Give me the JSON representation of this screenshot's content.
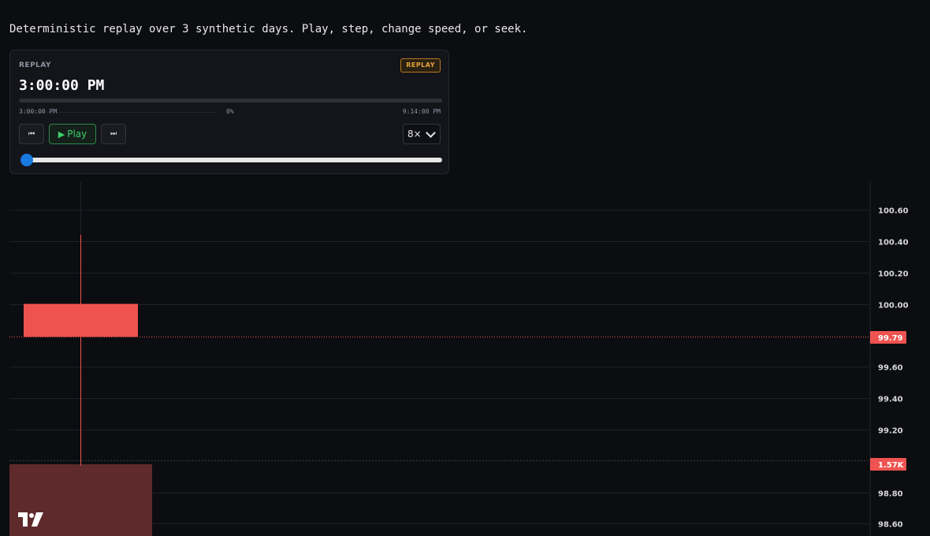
{
  "intro": "Deterministic replay over 3 synthetic days. Play, step, change speed, or seek.",
  "panel": {
    "label": "REPLAY",
    "badge": "REPLAY",
    "time": "3:00:00 PM",
    "start_time": "3:00:00 PM",
    "progress_pct": "0%",
    "end_time": "9:14:00 PM",
    "progress_fraction": 0,
    "slider_fraction": 0,
    "play_label": "Play",
    "speed": "8×"
  },
  "chart": {
    "y_ticks": [
      "100.60",
      "100.40",
      "100.20",
      "100.00",
      "99.60",
      "99.40",
      "99.20",
      "98.80",
      "98.60"
    ],
    "last_price": "99.79",
    "volume_tag": "1.57K",
    "candle": {
      "open": 100.0,
      "close": 99.79,
      "high": 100.44,
      "low": 98.97
    },
    "colors": {
      "down": "#ef5350",
      "volume": "#5e2a2c",
      "grid": "#1f2128",
      "badge": "#ef5350"
    }
  }
}
